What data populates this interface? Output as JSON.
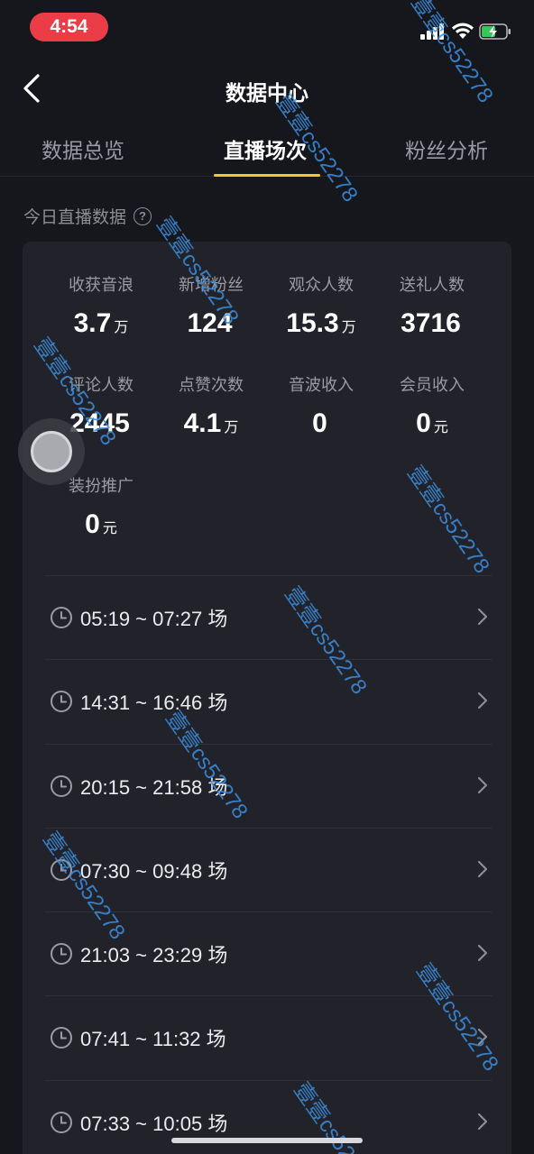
{
  "status_bar": {
    "time": "4:54"
  },
  "nav": {
    "title": "数据中心"
  },
  "tabs": [
    {
      "label": "数据总览",
      "active": false
    },
    {
      "label": "直播场次",
      "active": true
    },
    {
      "label": "粉丝分析",
      "active": false
    }
  ],
  "section": {
    "label": "今日直播数据",
    "help": "?"
  },
  "stats": [
    {
      "label": "收获音浪",
      "value": "3.7",
      "unit": "万"
    },
    {
      "label": "新增粉丝",
      "value": "124",
      "unit": ""
    },
    {
      "label": "观众人数",
      "value": "15.3",
      "unit": "万"
    },
    {
      "label": "送礼人数",
      "value": "3716",
      "unit": ""
    },
    {
      "label": "评论人数",
      "value": "2445",
      "unit": ""
    },
    {
      "label": "点赞次数",
      "value": "4.1",
      "unit": "万"
    },
    {
      "label": "音波收入",
      "value": "0",
      "unit": ""
    },
    {
      "label": "会员收入",
      "value": "0",
      "unit": "元"
    },
    {
      "label": "装扮推广",
      "value": "0",
      "unit": "元"
    }
  ],
  "sessions": [
    {
      "time": "05:19 ~ 07:27",
      "suffix": "场"
    },
    {
      "time": "14:31 ~ 16:46",
      "suffix": "场"
    },
    {
      "time": "20:15 ~ 21:58",
      "suffix": "场"
    },
    {
      "time": "07:30 ~ 09:48",
      "suffix": "场"
    },
    {
      "time": "21:03 ~ 23:29",
      "suffix": "场"
    },
    {
      "time": "07:41 ~ 11:32",
      "suffix": "场"
    },
    {
      "time": "07:33 ~ 10:05",
      "suffix": "场"
    }
  ],
  "watermark": {
    "text": "壹壹cs52278"
  },
  "colors": {
    "accent": "#f9c52d",
    "time_pill": "#ea3d48",
    "background": "#16171d",
    "card": "#22232a"
  }
}
